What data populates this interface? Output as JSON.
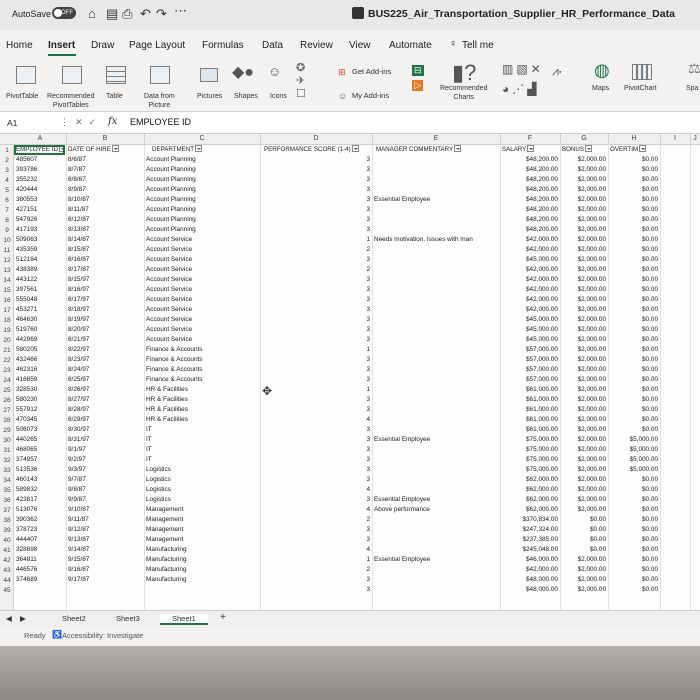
{
  "window": {
    "autosave_label": "AutoSave",
    "autosave_state": "OFF",
    "title": "BUS225_Air_Transportation_Supplier_HR_Performance_Data"
  },
  "menu": [
    "Home",
    "Insert",
    "Draw",
    "Page Layout",
    "Formulas",
    "Data",
    "Review",
    "View",
    "Automate",
    "Tell me"
  ],
  "ribbon": {
    "pivot_table": "PivotTable",
    "recommended_pivot": "Recommended\nPivotTables",
    "table": "Table",
    "data_from_picture": "Data from\nPicture",
    "pictures": "Pictures",
    "shapes": "Shapes",
    "icons": "Icons",
    "get_addins": "Get Add-ins",
    "my_addins": "My Add-ins",
    "recommended_charts": "Recommended\nCharts",
    "maps": "Maps",
    "pivot_chart": "PivotChart",
    "spa": "Spa"
  },
  "formula_bar": {
    "cell_ref": "A1",
    "formula": "EMPLOYEE ID"
  },
  "columns": [
    "A",
    "B",
    "C",
    "D",
    "E",
    "F",
    "G",
    "H",
    "I",
    "J"
  ],
  "headers": [
    "EMPLOYEE ID",
    "DATE OF HIRE",
    "DEPARTMENT",
    "PERFORMANCE SCORE (1-4)",
    "MANAGER COMMENTARY",
    "SALARY",
    "BONUS",
    "OVERTIM"
  ],
  "rows": [
    [
      "485607",
      "8/6/87",
      "Account Planning",
      "3",
      "",
      "$48,200.00",
      "$2,000.00",
      "$0.00"
    ],
    [
      "393786",
      "8/7/87",
      "Account Planning",
      "3",
      "",
      "$48,200.00",
      "$2,000.00",
      "$0.00"
    ],
    [
      "355232",
      "8/8/87",
      "Account Planning",
      "3",
      "",
      "$48,200.00",
      "$2,000.00",
      "$0.00"
    ],
    [
      "420444",
      "8/9/87",
      "Account Planning",
      "3",
      "",
      "$48,200.00",
      "$2,000.00",
      "$0.00"
    ],
    [
      "380553",
      "8/10/87",
      "Account Planning",
      "3",
      "Essential Employee",
      "$48,200.00",
      "$2,000.00",
      "$0.00"
    ],
    [
      "427151",
      "8/11/87",
      "Account Planning",
      "3",
      "",
      "$48,200.00",
      "$2,000.00",
      "$0.00"
    ],
    [
      "547926",
      "8/12/87",
      "Account Planning",
      "3",
      "",
      "$48,200.00",
      "$2,000.00",
      "$0.00"
    ],
    [
      "417193",
      "8/13/87",
      "Account Planning",
      "3",
      "",
      "$48,200.00",
      "$2,000.00",
      "$0.00"
    ],
    [
      "509063",
      "8/14/87",
      "Account Service",
      "1",
      "Needs motivation. Issues with man",
      "$42,000.00",
      "$2,000.00",
      "$0.00"
    ],
    [
      "435359",
      "8/15/87",
      "Account Service",
      "2",
      "",
      "$42,000.00",
      "$2,000.00",
      "$0.00"
    ],
    [
      "512184",
      "8/16/87",
      "Account Service",
      "3",
      "",
      "$45,000.00",
      "$2,000.00",
      "$0.00"
    ],
    [
      "438389",
      "8/17/87",
      "Account Service",
      "2",
      "",
      "$42,000.00",
      "$2,000.00",
      "$0.00"
    ],
    [
      "443122",
      "8/15/97",
      "Account Service",
      "3",
      "",
      "$42,000.00",
      "$2,000.00",
      "$0.00"
    ],
    [
      "397561",
      "8/16/97",
      "Account Service",
      "3",
      "",
      "$42,000.00",
      "$2,000.00",
      "$0.00"
    ],
    [
      "555048",
      "8/17/97",
      "Account Service",
      "3",
      "",
      "$42,000.00",
      "$2,000.00",
      "$0.00"
    ],
    [
      "453271",
      "8/18/97",
      "Account Service",
      "3",
      "",
      "$42,000.00",
      "$2,000.00",
      "$0.00"
    ],
    [
      "464630",
      "8/19/97",
      "Account Service",
      "3",
      "",
      "$45,000.00",
      "$2,000.00",
      "$0.00"
    ],
    [
      "519760",
      "8/20/97",
      "Account Service",
      "3",
      "",
      "$45,000.00",
      "$2,000.00",
      "$0.00"
    ],
    [
      "442969",
      "8/21/97",
      "Account Service",
      "3",
      "",
      "$45,000.00",
      "$2,000.00",
      "$0.00"
    ],
    [
      "580205",
      "8/22/97",
      "Finance & Accounts",
      "1",
      "",
      "$57,000.00",
      "$2,000.00",
      "$0.00"
    ],
    [
      "432466",
      "8/23/97",
      "Finance & Accounts",
      "3",
      "",
      "$57,000.00",
      "$2,000.00",
      "$0.00"
    ],
    [
      "462316",
      "8/24/97",
      "Finance & Accounts",
      "3",
      "",
      "$57,000.00",
      "$2,000.00",
      "$0.00"
    ],
    [
      "416859",
      "8/25/97",
      "Finance & Accounts",
      "3",
      "",
      "$57,000.00",
      "$2,000.00",
      "$0.00"
    ],
    [
      "328530",
      "8/26/97",
      "HR & Facilities",
      "1",
      "",
      "$61,000.00",
      "$2,000.00",
      "$0.00"
    ],
    [
      "580230",
      "8/27/97",
      "HR & Facilities",
      "3",
      "",
      "$61,000.00",
      "$2,000.00",
      "$0.00"
    ],
    [
      "557912",
      "8/28/97",
      "HR & Facilities",
      "3",
      "",
      "$61,000.00",
      "$2,000.00",
      "$0.00"
    ],
    [
      "470345",
      "8/29/97",
      "HR & Facilities",
      "4",
      "",
      "$61,000.00",
      "$2,000.00",
      "$0.00"
    ],
    [
      "506073",
      "8/30/97",
      "IT",
      "3",
      "",
      "$61,000.00",
      "$2,000.00",
      "$0.00"
    ],
    [
      "440265",
      "8/31/97",
      "IT",
      "3",
      "Essential Employee",
      "$75,000.00",
      "$2,000.00",
      "$5,000.00"
    ],
    [
      "468065",
      "9/1/97",
      "IT",
      "3",
      "",
      "$75,000.00",
      "$2,000.00",
      "$5,000.00"
    ],
    [
      "374957",
      "9/2/97",
      "IT",
      "3",
      "",
      "$75,000.00",
      "$2,000.00",
      "$5,000.00"
    ],
    [
      "513536",
      "9/3/97",
      "Logistics",
      "3",
      "",
      "$75,000.00",
      "$2,000.00",
      "$5,000.00"
    ],
    [
      "460143",
      "9/7/87",
      "Logistics",
      "3",
      "",
      "$62,000.00",
      "$2,000.00",
      "$0.00"
    ],
    [
      "589832",
      "9/8/87",
      "Logistics",
      "4",
      "",
      "$62,000.00",
      "$2,000.00",
      "$0.00"
    ],
    [
      "423817",
      "9/9/87",
      "Logistics",
      "3",
      "Essential Employee",
      "$62,000.00",
      "$2,000.00",
      "$0.00"
    ],
    [
      "513076",
      "9/10/87",
      "Management",
      "4",
      "Above performance",
      "$62,000.00",
      "$2,000.00",
      "$0.00"
    ],
    [
      "390362",
      "9/11/87",
      "Management",
      "2",
      "",
      "$370,834.00",
      "$0.00",
      "$0.00"
    ],
    [
      "378723",
      "9/12/87",
      "Management",
      "3",
      "",
      "$247,324.00",
      "$0.00",
      "$0.00"
    ],
    [
      "444407",
      "9/13/87",
      "Management",
      "3",
      "",
      "$237,385.00",
      "$0.00",
      "$0.00"
    ],
    [
      "328698",
      "9/14/87",
      "Manufacturing",
      "4",
      "",
      "$245,048.00",
      "$0.00",
      "$0.00"
    ],
    [
      "364811",
      "9/15/87",
      "Manufacturing",
      "1",
      "Essential Employee",
      "$46,000.00",
      "$2,000.00",
      "$0.00"
    ],
    [
      "446576",
      "9/16/87",
      "Manufacturing",
      "2",
      "",
      "$42,000.00",
      "$2,000.00",
      "$0.00"
    ],
    [
      "374689",
      "9/17/87",
      "Manufacturing",
      "3",
      "",
      "$48,000.00",
      "$2,000.00",
      "$0.00"
    ],
    [
      "",
      "",
      "",
      "3",
      "",
      "$48,000.00",
      "$2,000.00",
      "$0.00"
    ]
  ],
  "sheets": [
    "Sheet2",
    "Sheet3",
    "Sheet1"
  ],
  "status": {
    "ready": "Ready",
    "accessibility": "Accessibility: Investigate"
  }
}
